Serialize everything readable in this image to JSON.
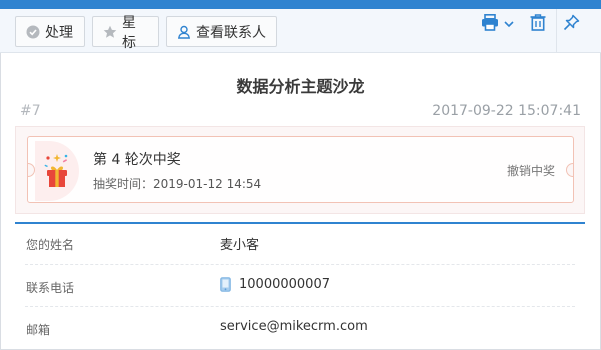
{
  "toolbar": {
    "handle_label": "处理",
    "star_label": "星标",
    "contacts_label": "查看联系人"
  },
  "record": {
    "title": "数据分析主题沙龙",
    "number": "#7",
    "timestamp": "2017-09-22 15:07:41"
  },
  "prize": {
    "name": "第 4 轮次中奖",
    "draw_time_label": "抽奖时间：",
    "draw_time": "2019-01-12 14:54",
    "revoke_label": "撤销中奖"
  },
  "fields": [
    {
      "label": "您的姓名",
      "value": "麦小客"
    },
    {
      "label": "联系电话",
      "value": "10000000007"
    },
    {
      "label": "邮箱",
      "value": "service@mikecrm.com"
    }
  ],
  "colors": {
    "accent": "#2f83d0",
    "ticket_border": "#f2c2b5",
    "gift_red": "#e8463a"
  },
  "icons": {
    "handle": "check-circle-icon",
    "star": "star-icon",
    "contacts": "user-icon",
    "print": "printer-icon",
    "dropdown": "chevron-down-icon",
    "delete": "trash-icon",
    "pin": "pin-icon",
    "gift": "gift-icon",
    "phone": "phone-icon"
  }
}
